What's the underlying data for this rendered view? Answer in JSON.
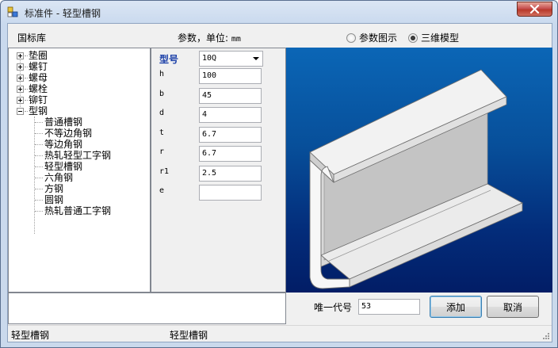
{
  "window": {
    "title": "标准件 - 轻型槽钢"
  },
  "header": {
    "library_label": "国标库",
    "params_label": "参数，单位:",
    "params_unit": "mm",
    "view_options": [
      {
        "label": "参数图示",
        "checked": false
      },
      {
        "label": "三维模型",
        "checked": true
      }
    ]
  },
  "tree": {
    "root_items": [
      "垫圈",
      "螺钉",
      "螺母",
      "螺栓",
      "铆钉",
      "型钢"
    ],
    "expanded_children": [
      "普通槽钢",
      "不等边角钢",
      "等边角钢",
      "热轧轻型工字钢",
      "轻型槽钢",
      "六角钢",
      "方钢",
      "圆钢",
      "热轧普通工字钢"
    ]
  },
  "params": {
    "model_label": "型号",
    "model_value": "10Q",
    "fields": [
      {
        "name": "h",
        "value": "100"
      },
      {
        "name": "b",
        "value": "45"
      },
      {
        "name": "d",
        "value": "4"
      },
      {
        "name": "t",
        "value": "6.7"
      },
      {
        "name": "r",
        "value": "6.7"
      },
      {
        "name": "r1",
        "value": "2.5"
      },
      {
        "name": "e",
        "value": ""
      }
    ]
  },
  "footer": {
    "code_label": "唯一代号",
    "code_value": "53",
    "add_label": "添加",
    "cancel_label": "取消"
  },
  "status": {
    "left": "轻型槽钢",
    "right": "轻型槽钢"
  },
  "colors": {
    "accent_blue": "#1a3fa8",
    "view_top": "#0b66b6",
    "view_bottom": "#021d66",
    "close_red": "#c75050"
  }
}
